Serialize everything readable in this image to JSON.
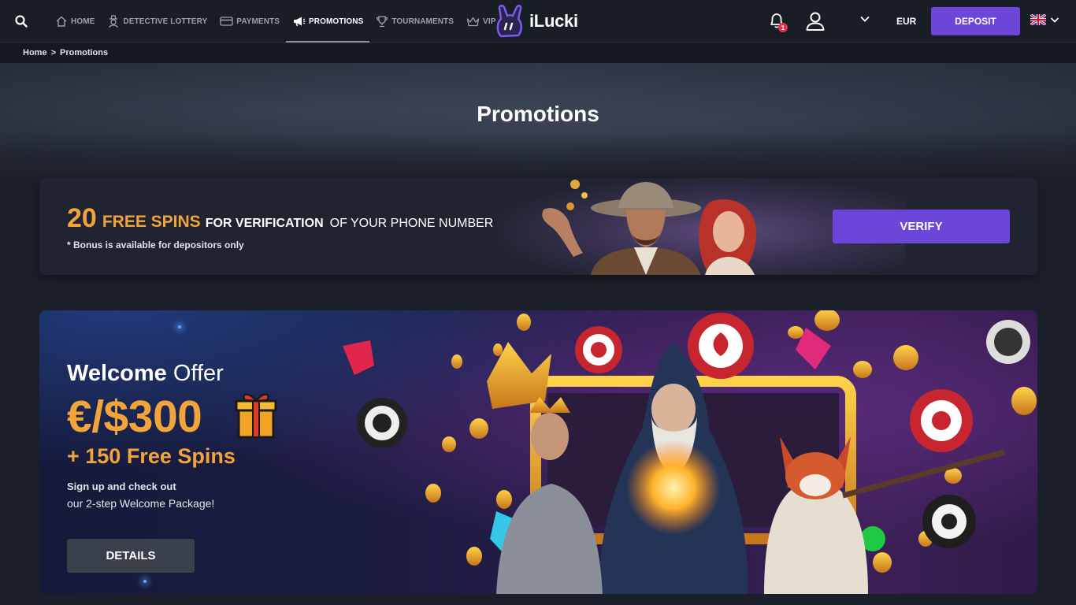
{
  "header": {
    "nav": [
      {
        "label": "HOME",
        "icon": "home-icon"
      },
      {
        "label": "DETECTIVE LOTTERY",
        "icon": "detective-icon"
      },
      {
        "label": "PAYMENTS",
        "icon": "card-icon"
      },
      {
        "label": "PROMOTIONS",
        "icon": "megaphone-icon",
        "active": true
      },
      {
        "label": "TOURNAMENTS",
        "icon": "trophy-icon"
      },
      {
        "label": "VIP",
        "icon": "crown-icon"
      }
    ],
    "logo_text": "iLucki",
    "notifications_count": "1",
    "currency": "EUR",
    "deposit_label": "DEPOSIT",
    "language_flag": "uk-flag-icon"
  },
  "breadcrumb": {
    "home": "Home",
    "separator": ">",
    "current": "Promotions"
  },
  "page": {
    "title": "Promotions"
  },
  "verify_banner": {
    "number": "20",
    "free_spins": "FREE SPINS",
    "for_verification": "FOR VERIFICATION",
    "phone": "OF YOUR PHONE NUMBER",
    "note": "* Bonus is available for depositors only",
    "button_label": "VERIFY"
  },
  "welcome_banner": {
    "title_bold": "Welcome",
    "title_rest": "Offer",
    "amount": "€/$300",
    "spins": "+ 150 Free Spins",
    "desc_line1": "Sign up and check out",
    "desc_line2": "our 2-step Welcome Package!",
    "button_label": "DETAILS"
  },
  "colors": {
    "accent": "#6b46d8",
    "highlight": "#f2a43a",
    "background": "#1b1f29",
    "header": "#191d26"
  }
}
